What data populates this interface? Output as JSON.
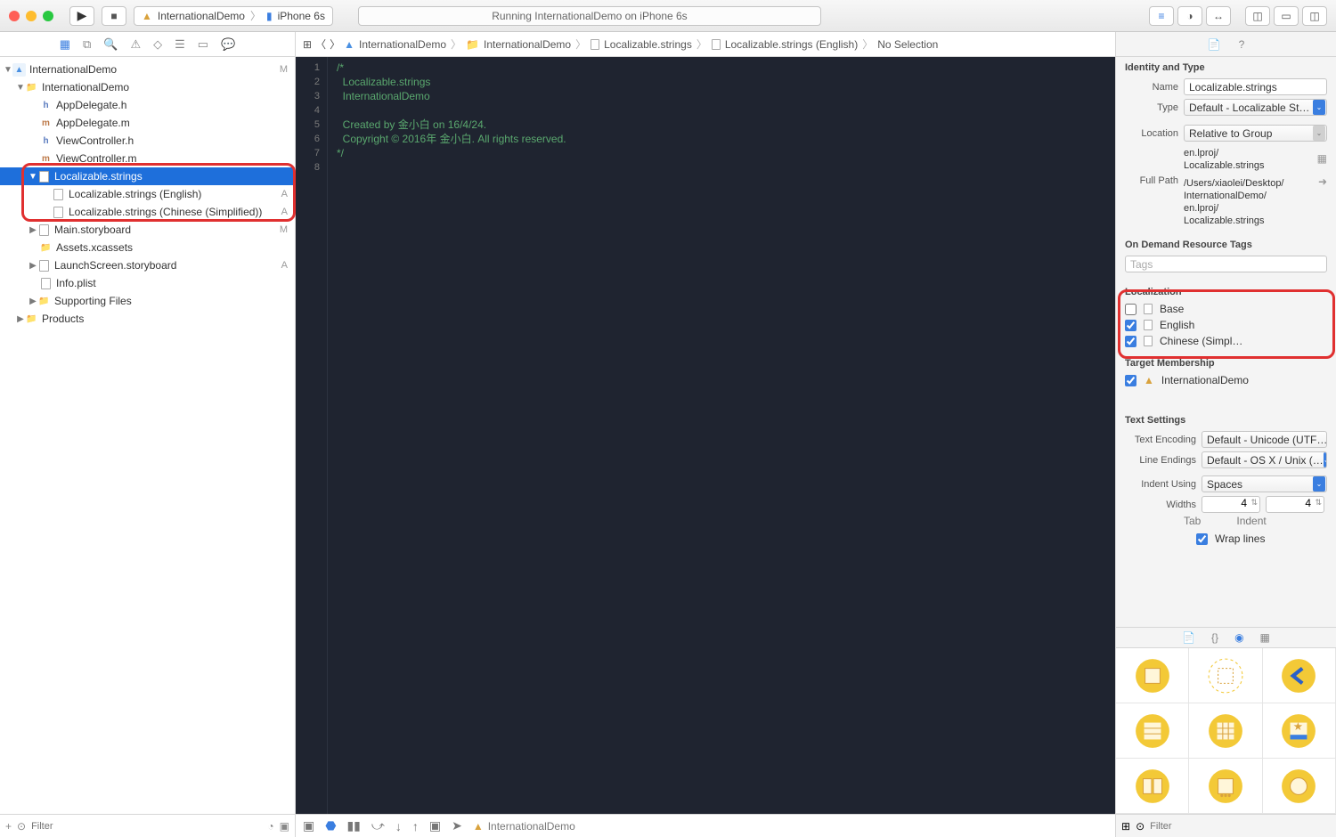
{
  "toolbar": {
    "scheme_project": "InternationalDemo",
    "scheme_device": "iPhone 6s",
    "status": "Running InternationalDemo on iPhone 6s"
  },
  "navigator": {
    "root": "InternationalDemo",
    "root_badge": "M",
    "group": "InternationalDemo",
    "files": {
      "appdeleg_h": "AppDelegate.h",
      "appdeleg_m": "AppDelegate.m",
      "vc_h": "ViewController.h",
      "vc_m": "ViewController.m",
      "localizable": "Localizable.strings",
      "loc_en": "Localizable.strings (English)",
      "loc_en_badge": "A",
      "loc_cn": "Localizable.strings (Chinese (Simplified))",
      "loc_cn_badge": "A",
      "main_sb": "Main.storyboard",
      "main_sb_badge": "M",
      "assets": "Assets.xcassets",
      "launch_sb": "LaunchScreen.storyboard",
      "launch_sb_badge": "A",
      "info": "Info.plist",
      "supporting": "Supporting Files",
      "products": "Products"
    },
    "filter_placeholder": "Filter"
  },
  "jumpbar": {
    "project": "InternationalDemo",
    "group": "InternationalDemo",
    "file": "Localizable.strings",
    "subfile": "Localizable.strings (English)",
    "selection": "No Selection"
  },
  "code": {
    "lines": [
      "/*",
      "  Localizable.strings",
      "  InternationalDemo",
      "",
      "  Created by 金小白 on 16/4/24.",
      "  Copyright © 2016年 金小白. All rights reserved.",
      "*/",
      ""
    ]
  },
  "bottombar": {
    "target": "InternationalDemo"
  },
  "inspector": {
    "identity_title": "Identity and Type",
    "name_label": "Name",
    "name_value": "Localizable.strings",
    "type_label": "Type",
    "type_value": "Default - Localizable St…",
    "location_label": "Location",
    "location_value": "Relative to Group",
    "location_path": "en.lproj/\nLocalizable.strings",
    "fullpath_label": "Full Path",
    "fullpath_value": "/Users/xiaolei/Desktop/\nInternationalDemo/\nen.lproj/\nLocalizable.strings",
    "odr_title": "On Demand Resource Tags",
    "odr_placeholder": "Tags",
    "loc_title": "Localization",
    "loc_base": "Base",
    "loc_en": "English",
    "loc_cn": "Chinese (Simpl…",
    "target_title": "Target Membership",
    "target_name": "InternationalDemo",
    "text_title": "Text Settings",
    "enc_label": "Text Encoding",
    "enc_value": "Default - Unicode (UTF…",
    "le_label": "Line Endings",
    "le_value": "Default - OS X / Unix (…",
    "indent_label": "Indent Using",
    "indent_value": "Spaces",
    "widths_label": "Widths",
    "tab_value": "4",
    "indent_value2": "4",
    "tab_sub": "Tab",
    "indent_sub": "Indent",
    "wrap_label": "Wrap lines",
    "filter_placeholder": "Filter"
  }
}
